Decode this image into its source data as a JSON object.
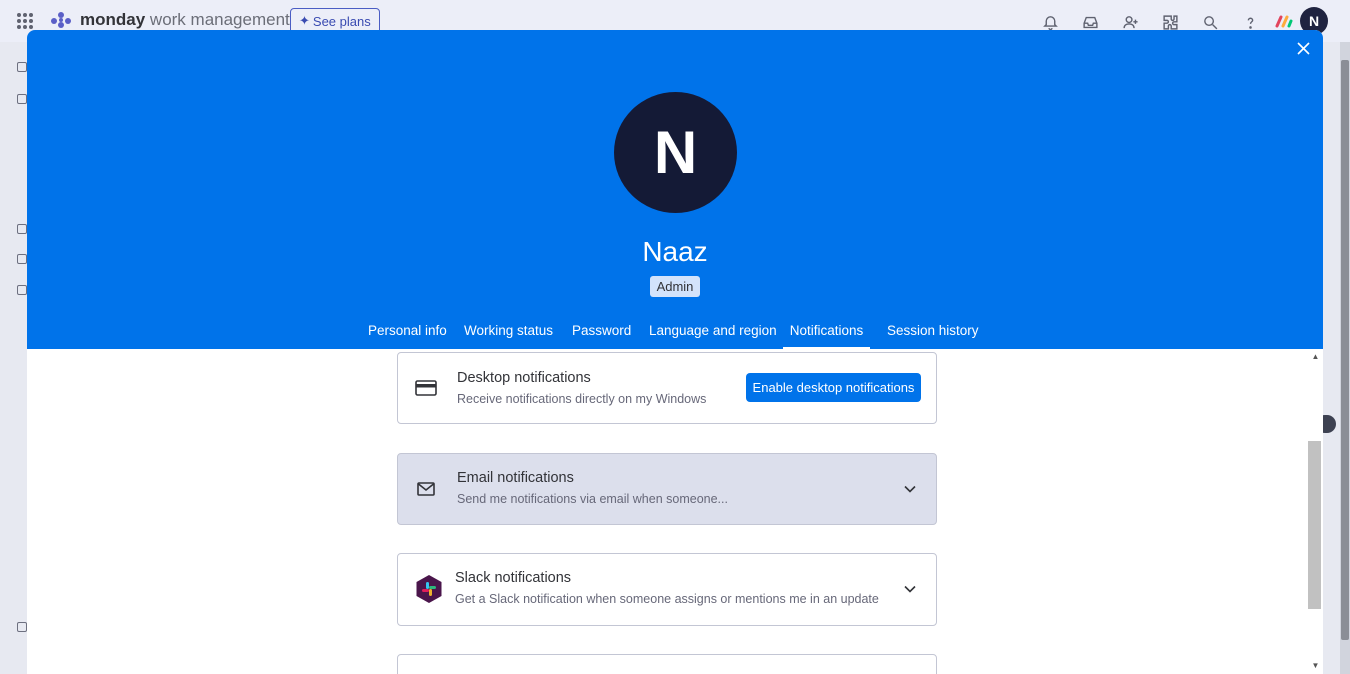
{
  "app": {
    "brand_bold": "monday",
    "brand_light": " work management",
    "see_plans_label": "See plans",
    "user_initial": "N",
    "top_icons": [
      "bell-icon",
      "inbox-icon",
      "invite-members-icon",
      "apps-icon",
      "search-icon",
      "help-icon"
    ]
  },
  "profile": {
    "avatar_initial": "N",
    "name": "Naaz",
    "role": "Admin",
    "header_color": "#0073ea",
    "avatar_color": "#141a36"
  },
  "tabs": [
    {
      "label": "Personal info",
      "active": false
    },
    {
      "label": "Working status",
      "active": false
    },
    {
      "label": "Password",
      "active": false
    },
    {
      "label": "Language and region",
      "active": false
    },
    {
      "label": "Notifications",
      "active": true
    },
    {
      "label": "Session history",
      "active": false
    }
  ],
  "notifications": {
    "desktop": {
      "icon": "desktop-card-icon",
      "title": "Desktop notifications",
      "description": "Receive notifications directly on my Windows",
      "button_label": "Enable desktop notifications"
    },
    "email": {
      "icon": "envelope-icon",
      "title": "Email notifications",
      "description": "Send me notifications via email when someone..."
    },
    "slack": {
      "icon": "slack-icon",
      "title": "Slack notifications",
      "description": "Get a Slack notification when someone assigns or mentions me in an update"
    }
  }
}
